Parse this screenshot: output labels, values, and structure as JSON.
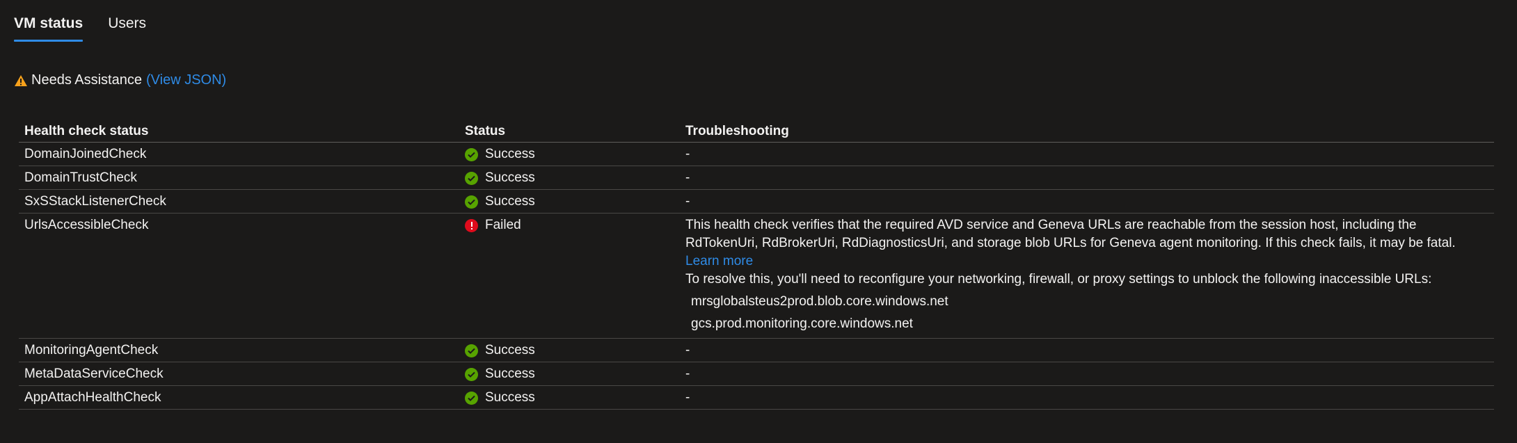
{
  "tabs": [
    {
      "label": "VM status",
      "active": true
    },
    {
      "label": "Users",
      "active": false
    }
  ],
  "status": {
    "icon": "warning-icon",
    "text": "Needs Assistance",
    "link": "(View JSON)",
    "color": "#f7a11b"
  },
  "table": {
    "headers": {
      "name": "Health check status",
      "status": "Status",
      "troubleshooting": "Troubleshooting"
    },
    "rows": [
      {
        "name": "DomainJoinedCheck",
        "status": "Success",
        "troubleshooting": "-"
      },
      {
        "name": "DomainTrustCheck",
        "status": "Success",
        "troubleshooting": "-"
      },
      {
        "name": "SxSStackListenerCheck",
        "status": "Success",
        "troubleshooting": "-"
      },
      {
        "name": "UrlsAccessibleCheck",
        "status": "Failed",
        "troubleshooting": "This health check verifies that the required AVD service and Geneva URLs are reachable from the session host, including the RdTokenUri, RdBrokerUri, RdDiagnosticsUri, and storage blob URLs for Geneva agent monitoring. If this check fails, it may be fatal.",
        "learn_more": "Learn more",
        "resolve_text": "To resolve this, you'll need to reconfigure your networking, firewall, or proxy settings to unblock the following inaccessible URLs:",
        "urls": [
          "mrsglobalsteus2prod.blob.core.windows.net",
          "gcs.prod.monitoring.core.windows.net"
        ]
      },
      {
        "name": "MonitoringAgentCheck",
        "status": "Success",
        "troubleshooting": "-"
      },
      {
        "name": "MetaDataServiceCheck",
        "status": "Success",
        "troubleshooting": "-"
      },
      {
        "name": "AppAttachHealthCheck",
        "status": "Success",
        "troubleshooting": "-"
      }
    ]
  },
  "colors": {
    "background": "#1b1a19",
    "accent": "#2f8be6",
    "success": "#57a300",
    "failed": "#e00b1c"
  }
}
